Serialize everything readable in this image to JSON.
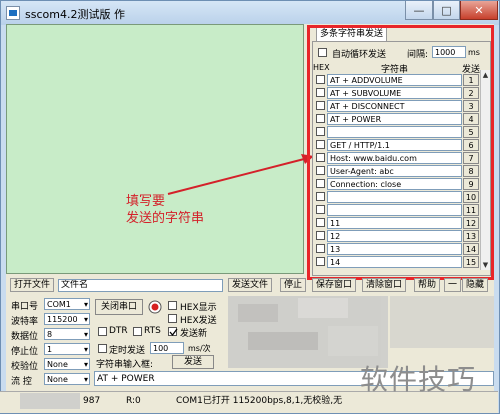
{
  "window": {
    "title": "sscom4.2测试版 作",
    "minimize": "—",
    "maximize": "□",
    "close": "✕"
  },
  "multi_send": {
    "tab_label": "多条字符串发送",
    "auto_loop_label": "自动循环发送",
    "interval_label": "间隔:",
    "interval_value": "1000",
    "interval_unit": "ms",
    "col_hex": "HEX",
    "col_string": "字符串",
    "col_send": "发送",
    "rows": [
      {
        "text": "AT + ADDVOLUME",
        "btn": "1"
      },
      {
        "text": "AT + SUBVOLUME",
        "btn": "2"
      },
      {
        "text": "AT + DISCONNECT",
        "btn": "3"
      },
      {
        "text": "AT + POWER",
        "btn": "4"
      },
      {
        "text": "",
        "btn": "5"
      },
      {
        "text": "GET / HTTP/1.1",
        "btn": "6"
      },
      {
        "text": "Host: www.baidu.com",
        "btn": "7"
      },
      {
        "text": "User-Agent: abc",
        "btn": "8"
      },
      {
        "text": "Connection: close",
        "btn": "9"
      },
      {
        "text": "",
        "btn": "10"
      },
      {
        "text": "",
        "btn": "11"
      },
      {
        "text": "11",
        "btn": "12"
      },
      {
        "text": "12",
        "btn": "13"
      },
      {
        "text": "13",
        "btn": "14"
      },
      {
        "text": "14",
        "btn": "15"
      }
    ]
  },
  "annotation": {
    "line1": "填写要",
    "line2": "发送的字符串"
  },
  "toolbar": {
    "open_file": "打开文件",
    "file_name": "文件名",
    "send_file": "发送文件",
    "stop": "停止",
    "save_window": "保存窗口",
    "clear_window": "清除窗口",
    "help": "帮助",
    "dash": "一",
    "hide": "隐藏"
  },
  "serial": {
    "port_label": "串口号",
    "port_value": "COM1",
    "baud_label": "波特率",
    "baud_value": "115200",
    "data_label": "数据位",
    "data_value": "8",
    "stop_label": "停止位",
    "stop_value": "1",
    "parity_label": "校验位",
    "parity_value": "None",
    "flow_label": "流 控",
    "flow_value": "None",
    "close_port": "关闭串口",
    "hex_display": "HEX显示",
    "hex_send": "HEX发送",
    "dtr": "DTR",
    "rts": "RTS",
    "send_newline": "发送新",
    "timed_send": "定时发送",
    "timed_value": "100",
    "timed_unit": "ms/次",
    "input_label": "字符串输入框:",
    "send_btn": "发送",
    "input_value": "AT + POWER"
  },
  "status": {
    "s_count": "987",
    "r_count": "R:0",
    "port_status": "COM1已打开  115200bps,8,1,无校验,无"
  },
  "watermark": "软件技巧"
}
